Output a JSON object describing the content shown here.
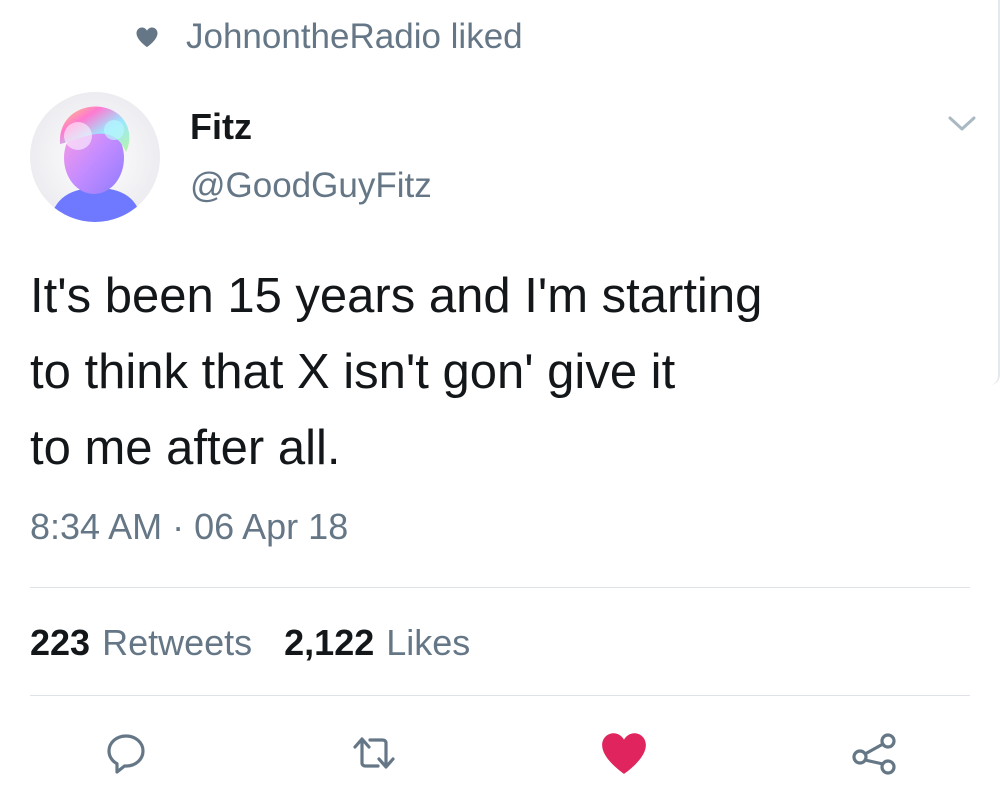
{
  "social_context": {
    "icon": "heart-icon",
    "text": "JohnontheRadio liked"
  },
  "author": {
    "display_name": "Fitz",
    "handle": "@GoodGuyFitz",
    "avatar": "avatar-image"
  },
  "tweet": {
    "text_lines": [
      "It's been 15 years and I'm starting",
      "to think that X isn't gon' give it",
      "to me after all."
    ],
    "time": "8:34 AM",
    "separator": "·",
    "date": "06 Apr 18"
  },
  "stats": {
    "retweets_count": "223",
    "retweets_label": "Retweets",
    "likes_count": "2,122",
    "likes_label": "Likes"
  },
  "actions": {
    "reply_icon": "reply-icon",
    "retweet_icon": "retweet-icon",
    "like_icon": "heart-filled-icon",
    "share_icon": "share-icon"
  },
  "colors": {
    "primary_text": "#14171a",
    "secondary_text": "#657786",
    "like_red": "#e0245e",
    "divider": "#dfe3e8",
    "icon_gray": "#657786"
  }
}
